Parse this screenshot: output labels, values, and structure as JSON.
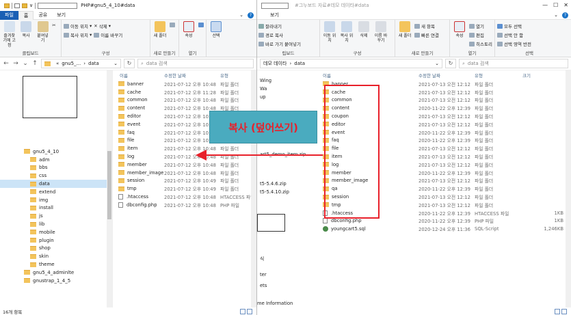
{
  "left": {
    "title_suffix": "PHP#gnu5_4_10#data",
    "tabs": [
      "파일",
      "홈",
      "공유",
      "보기"
    ],
    "ribbon": {
      "pin": "즐겨찾기에 고정",
      "copy": "복사",
      "paste": "붙여넣기",
      "move_to": "이동 위치",
      "copy_to": "복사 위치",
      "delete": "삭제",
      "rename": "이름 바꾸기",
      "new_folder": "새 폴더",
      "properties": "속성",
      "select": "선택",
      "group_clipboard": "클립보드",
      "group_organize": "구성",
      "group_new": "새로 만들기",
      "group_open": "열기"
    },
    "address": {
      "prefix": "«",
      "seg1": "gnu5_...",
      "seg2": "data"
    },
    "search_placeholder": "data 검색",
    "nav_items": [
      {
        "label": "gnu5_4_10",
        "indent": 0,
        "selected": false
      },
      {
        "label": "adm",
        "indent": 1,
        "selected": false
      },
      {
        "label": "bbs",
        "indent": 1,
        "selected": false
      },
      {
        "label": "css",
        "indent": 1,
        "selected": false
      },
      {
        "label": "data",
        "indent": 1,
        "selected": true
      },
      {
        "label": "extend",
        "indent": 1,
        "selected": false
      },
      {
        "label": "img",
        "indent": 1,
        "selected": false
      },
      {
        "label": "install",
        "indent": 1,
        "selected": false
      },
      {
        "label": "js",
        "indent": 1,
        "selected": false
      },
      {
        "label": "lib",
        "indent": 1,
        "selected": false
      },
      {
        "label": "mobile",
        "indent": 1,
        "selected": false
      },
      {
        "label": "plugin",
        "indent": 1,
        "selected": false
      },
      {
        "label": "shop",
        "indent": 1,
        "selected": false
      },
      {
        "label": "skin",
        "indent": 1,
        "selected": false
      },
      {
        "label": "theme",
        "indent": 1,
        "selected": false
      },
      {
        "label": "gnu5_4_adminlte",
        "indent": 0,
        "selected": false
      },
      {
        "label": "gnustrap_1_4_5",
        "indent": 0,
        "selected": false
      }
    ],
    "columns": {
      "name": "이름",
      "date": "수정한 날짜",
      "type": "유형"
    },
    "files": [
      {
        "name": "banner",
        "date": "2021-07-12 오후 10:48",
        "type": "파일 폴더",
        "kind": "folder"
      },
      {
        "name": "cache",
        "date": "2021-07-12 오후 11:28",
        "type": "파일 폴더",
        "kind": "folder"
      },
      {
        "name": "common",
        "date": "2021-07-12 오후 10:48",
        "type": "파일 폴더",
        "kind": "folder"
      },
      {
        "name": "content",
        "date": "2021-07-12 오후 10:48",
        "type": "파일 폴더",
        "kind": "folder"
      },
      {
        "name": "editor",
        "date": "2021-07-12 오후 10:48",
        "type": "파일 폴더",
        "kind": "folder"
      },
      {
        "name": "event",
        "date": "2021-07-12 오후 10:48",
        "type": "파일 폴더",
        "kind": "folder"
      },
      {
        "name": "faq",
        "date": "2021-07-12 오후 10:48",
        "type": "파일 폴더",
        "kind": "folder"
      },
      {
        "name": "file",
        "date": "2021-07-12 오후 10:48",
        "type": "파일 폴더",
        "kind": "folder"
      },
      {
        "name": "item",
        "date": "2021-07-12 오후 10:48",
        "type": "파일 폴더",
        "kind": "folder"
      },
      {
        "name": "log",
        "date": "2021-07-12 오후 10:48",
        "type": "파일 폴더",
        "kind": "folder"
      },
      {
        "name": "member",
        "date": "2021-07-12 오후 10:48",
        "type": "파일 폴더",
        "kind": "folder"
      },
      {
        "name": "member_image",
        "date": "2021-07-12 오후 10:48",
        "type": "파일 폴더",
        "kind": "folder"
      },
      {
        "name": "session",
        "date": "2021-07-12 오후 10:49",
        "type": "파일 폴더",
        "kind": "folder"
      },
      {
        "name": "tmp",
        "date": "2021-07-12 오후 10:49",
        "type": "파일 폴더",
        "kind": "folder"
      },
      {
        "name": ".htaccess",
        "date": "2021-07-12 오후 10:48",
        "type": "HTACCESS 파일",
        "kind": "doc"
      },
      {
        "name": "dbconfig.php",
        "date": "2021-07-12 오후 10:48",
        "type": "PHP 파일",
        "kind": "doc"
      }
    ],
    "status": "16개 항목"
  },
  "right": {
    "title": "#그누보드 자료#데모 데이타#data",
    "tab_view": "보기",
    "ribbon": {
      "cut": "잘라내기",
      "copy_path": "경로 복사",
      "paste_shortcut": "바로 가기 붙여넣기",
      "move_to": "이동 위치",
      "copy_to": "복사 위치",
      "delete": "삭제",
      "rename": "이름 바꾸기",
      "new_folder": "새 폴더",
      "new_item": "새 항목",
      "easy_access": "빠른 연결",
      "properties": "속성",
      "open": "열기",
      "edit": "편집",
      "history": "히스토리",
      "select_all": "모두 선택",
      "select_none": "선택 안 함",
      "invert": "선택 영역 반전",
      "group_clipboard": "립보드",
      "group_organize": "구성",
      "group_new": "새로 만들기",
      "group_open": "열기",
      "group_select": "선택"
    },
    "address": {
      "seg1": "데모 데이타",
      "seg2": "data"
    },
    "search_placeholder": "data 검색",
    "columns": {
      "name": "이름",
      "date": "수정한 날짜",
      "type": "유형",
      "size": "크기"
    },
    "files": [
      {
        "name": "banner",
        "date": "2021-07-13 오전 12:12",
        "type": "파일 폴더",
        "size": "",
        "kind": "folder"
      },
      {
        "name": "cache",
        "date": "2021-07-13 오전 12:12",
        "type": "파일 폴더",
        "size": "",
        "kind": "folder"
      },
      {
        "name": "common",
        "date": "2021-07-13 오전 12:12",
        "type": "파일 폴더",
        "size": "",
        "kind": "folder"
      },
      {
        "name": "content",
        "date": "2020-11-22 오후 12:39",
        "type": "파일 폴더",
        "size": "",
        "kind": "folder"
      },
      {
        "name": "coupon",
        "date": "2021-07-13 오전 12:12",
        "type": "파일 폴더",
        "size": "",
        "kind": "folder"
      },
      {
        "name": "editor",
        "date": "2021-07-13 오전 12:12",
        "type": "파일 폴더",
        "size": "",
        "kind": "folder"
      },
      {
        "name": "event",
        "date": "2020-11-22 오후 12:39",
        "type": "파일 폴더",
        "size": "",
        "kind": "folder"
      },
      {
        "name": "faq",
        "date": "2020-11-22 오후 12:39",
        "type": "파일 폴더",
        "size": "",
        "kind": "folder"
      },
      {
        "name": "file",
        "date": "2021-07-13 오전 12:12",
        "type": "파일 폴더",
        "size": "",
        "kind": "folder"
      },
      {
        "name": "item",
        "date": "2021-07-13 오전 12:12",
        "type": "파일 폴더",
        "size": "",
        "kind": "folder"
      },
      {
        "name": "log",
        "date": "2021-07-13 오전 12:12",
        "type": "파일 폴더",
        "size": "",
        "kind": "folder"
      },
      {
        "name": "member",
        "date": "2020-11-22 오후 12:39",
        "type": "파일 폴더",
        "size": "",
        "kind": "folder"
      },
      {
        "name": "member_image",
        "date": "2021-07-13 오전 12:12",
        "type": "파일 폴더",
        "size": "",
        "kind": "folder"
      },
      {
        "name": "qa",
        "date": "2020-11-22 오후 12:39",
        "type": "파일 폴더",
        "size": "",
        "kind": "folder"
      },
      {
        "name": "session",
        "date": "2021-07-13 오전 12:12",
        "type": "파일 폴더",
        "size": "",
        "kind": "folder"
      },
      {
        "name": "tmp",
        "date": "2021-07-13 오전 12:12",
        "type": "파일 폴더",
        "size": "",
        "kind": "folder"
      },
      {
        "name": ".htaccess",
        "date": "2020-11-22 오후 12:39",
        "type": "HTACCESS 파일",
        "size": "1KB",
        "kind": "doc"
      },
      {
        "name": "dbconfig.php",
        "date": "2020-11-22 오후 12:39",
        "type": "PHP 파일",
        "size": "1KB",
        "kind": "doc"
      },
      {
        "name": "youngcart5.sql",
        "date": "2020-12-24 오후 11:36",
        "type": "SQL-Script",
        "size": "1,246KB",
        "kind": "sql"
      }
    ]
  },
  "peek_texts": [
    "Wing",
    "Wa",
    "up",
    "art5_demo_item",
    "art5_demo_item.zip",
    "t5-5.4.6.zip",
    "t5-5.4.10.zip",
    "식",
    "ter",
    "ets",
    "me Information"
  ],
  "annotation": {
    "label": "복사 (덮어쓰기)",
    "color": "#e8202a"
  }
}
